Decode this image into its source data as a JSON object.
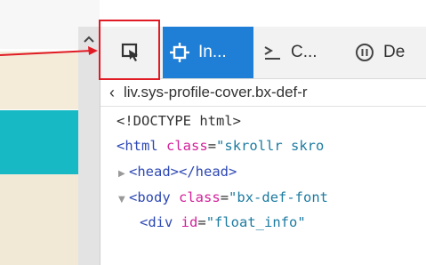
{
  "devtools": {
    "toolbar": {
      "pick_icon": "element-picker-icon",
      "inspector_label": "In...",
      "inspector_icon": "inspector-icon",
      "console_label": "C...",
      "console_icon": "console-icon",
      "debugger_label": "De",
      "debugger_icon": "debugger-pause-icon"
    },
    "breadcrumb": {
      "text": "liv.sys-profile-cover.bx-def-r"
    },
    "tree": {
      "doctype": "<!DOCTYPE html>",
      "html_open": "<html",
      "html_attr": "class",
      "html_eq": "=",
      "html_val": "\"skrollr skro",
      "head_tag": "<head></head>",
      "body_open": "<body",
      "body_attr": "class",
      "body_eq": "=",
      "body_val": "\"bx-def-font",
      "div_open": "<div",
      "div_attr": "id",
      "div_eq": "=",
      "div_val": "\"float_info\""
    }
  },
  "colors": {
    "accent": "#1f7ed6",
    "teal_banner": "#16b9c4",
    "annotation": "#e01b24"
  }
}
